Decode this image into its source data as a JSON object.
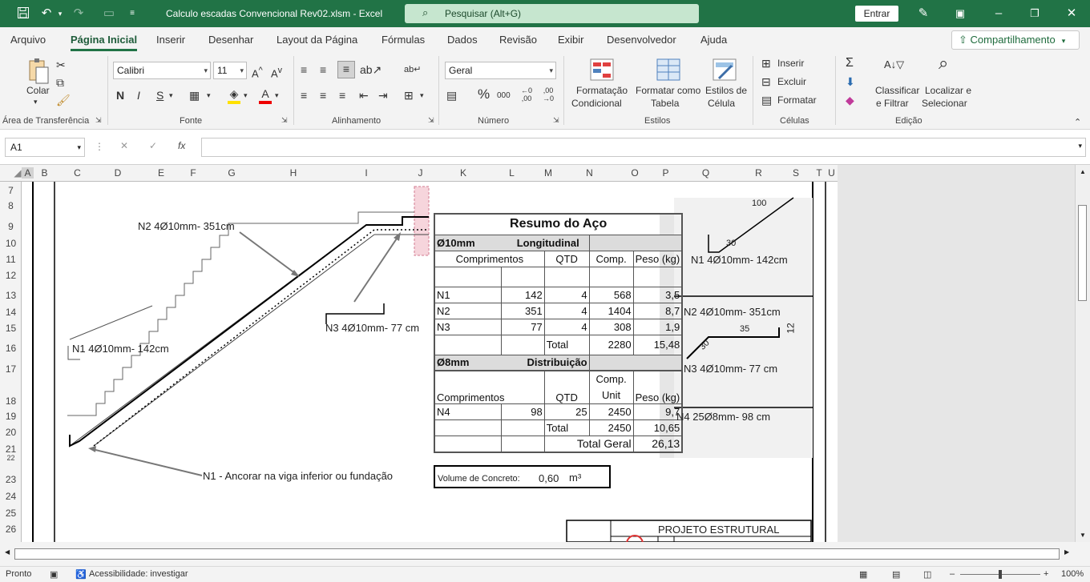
{
  "window": {
    "title": "Calculo escadas Convencional Rev02.xlsm  -  Excel",
    "search_placeholder": "Pesquisar (Alt+G)",
    "signin": "Entrar"
  },
  "menu": {
    "tabs": [
      "Arquivo",
      "Página Inicial",
      "Inserir",
      "Desenhar",
      "Layout da Página",
      "Fórmulas",
      "Dados",
      "Revisão",
      "Exibir",
      "Desenvolvedor",
      "Ajuda"
    ],
    "active": "Página Inicial",
    "share": "Compartilhamento"
  },
  "ribbon": {
    "clipboard": {
      "paste": "Colar",
      "group": "Área de Transferência"
    },
    "font": {
      "name": "Calibri",
      "size": "11",
      "bold": "N",
      "italic": "I",
      "underline": "S",
      "group": "Fonte"
    },
    "alignment": {
      "group": "Alinhamento"
    },
    "number": {
      "format": "Geral",
      "group": "Número"
    },
    "styles": {
      "cond1": "Formatação",
      "cond2": "Condicional",
      "table1": "Formatar como",
      "table2": "Tabela",
      "cell1": "Estilos de",
      "cell2": "Célula",
      "group": "Estilos"
    },
    "cells": {
      "insert": "Inserir",
      "delete": "Excluir",
      "format": "Formatar",
      "group": "Células"
    },
    "editing": {
      "sort1": "Classificar",
      "sort2": "e Filtrar",
      "find1": "Localizar e",
      "find2": "Selecionar",
      "group": "Edição"
    }
  },
  "formula_bar": {
    "name_box": "A1",
    "fx": "fx",
    "value": ""
  },
  "columns": [
    "A",
    "B",
    "C",
    "D",
    "E",
    "F",
    "G",
    "H",
    "I",
    "J",
    "K",
    "L",
    "M",
    "N",
    "O",
    "P",
    "Q",
    "R",
    "S",
    "T",
    "U"
  ],
  "rows": [
    "7",
    "8",
    "9",
    "10",
    "11",
    "12",
    "13",
    "14",
    "15",
    "16",
    "17",
    "18",
    "19",
    "20",
    "21",
    "22",
    "23",
    "24",
    "25",
    "26"
  ],
  "drawing": {
    "n2_label": "N2 4Ø10mm- 351cm",
    "n1_label": "N1 4Ø10mm- 142cm",
    "n3_label": "N3 4Ø10mm- 77 cm",
    "anchor_note": "N1 - Ancorar na viga inferior ou fundação"
  },
  "resumo": {
    "title": "Resumo do Aço",
    "d10": "Ø10mm",
    "longitudinal": "Longitudinal",
    "h_comprimentos": "Comprimentos",
    "h_qtd": "QTD",
    "h_comp": "Comp.",
    "h_peso": "Peso (kg)",
    "rows10": [
      [
        "N1",
        "142",
        "4",
        "568",
        "3,5"
      ],
      [
        "N2",
        "351",
        "4",
        "1404",
        "8,7"
      ],
      [
        "N3",
        "77",
        "4",
        "308",
        "1,9"
      ]
    ],
    "total_label": "Total",
    "total10_comp": "2280",
    "total10_peso": "15,48",
    "d8": "Ø8mm",
    "distribuicao": "Distribuição",
    "h_comp_unit1": "Comp.",
    "h_comp_unit2": "Unit",
    "rows8": [
      [
        "N4",
        "98",
        "25",
        "2450",
        "9,7"
      ]
    ],
    "total8_comp": "2450",
    "total8_peso": "10,65",
    "total_geral_label": "Total Geral",
    "total_geral": "26,13"
  },
  "concreto": {
    "label": "Volume de Concreto:",
    "value": "0,60",
    "unit": "m³"
  },
  "details": {
    "n1_dim_a": "100",
    "n1_dim_b": "30",
    "n1": "N1 4Ø10mm- 142cm",
    "n2": "N2 4Ø10mm- 351cm",
    "n3_dim_a": "35",
    "n3_dim_b": "12",
    "n3_dim_c": "30",
    "n3": "N3 4Ø10mm- 77 cm",
    "n4": "N4 25Ø8mm- 98 cm"
  },
  "project": {
    "title": "PROJETO ESTRUTURAL"
  },
  "status": {
    "ready": "Pronto",
    "accessibility": "Acessibilidade: investigar",
    "zoom": "100%"
  }
}
